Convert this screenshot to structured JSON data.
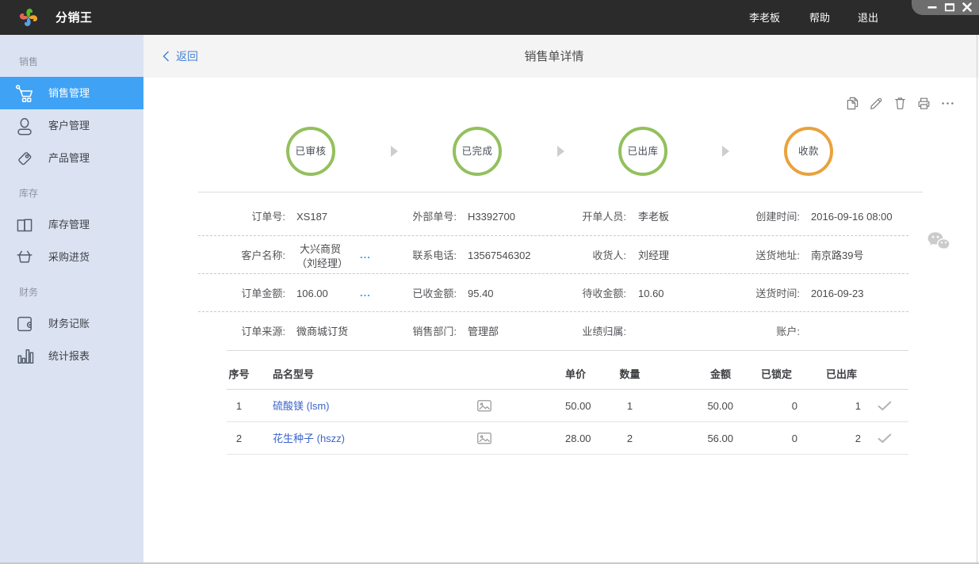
{
  "window": {
    "app_title": "分销王",
    "user": "李老板",
    "help": "帮助",
    "logout": "退出",
    "controls": [
      "minimize",
      "maximize",
      "close"
    ]
  },
  "sidebar": {
    "sections": [
      {
        "label": "销售",
        "items": [
          {
            "label": "销售管理",
            "icon": "cart-icon",
            "active": true
          },
          {
            "label": "客户管理",
            "icon": "user-icon",
            "active": false
          },
          {
            "label": "产品管理",
            "icon": "tag-icon",
            "active": false
          }
        ]
      },
      {
        "label": "库存",
        "items": [
          {
            "label": "库存管理",
            "icon": "book-icon",
            "active": false
          },
          {
            "label": "采购进货",
            "icon": "basket-icon",
            "active": false
          }
        ]
      },
      {
        "label": "财务",
        "items": [
          {
            "label": "财务记账",
            "icon": "wallet-icon",
            "active": false
          },
          {
            "label": "统计报表",
            "icon": "bar-chart-icon",
            "active": false
          }
        ]
      }
    ]
  },
  "header": {
    "back": "返回",
    "title": "销售单详情"
  },
  "toolbar": {
    "icons": [
      "copy-icon",
      "edit-icon",
      "delete-icon",
      "print-icon",
      "more-icon"
    ]
  },
  "steps": [
    {
      "label": "已审核",
      "color": "#93c05c"
    },
    {
      "label": "已完成",
      "color": "#93c05c"
    },
    {
      "label": "已出库",
      "color": "#93c05c"
    },
    {
      "label": "收款",
      "color": "#e9a23d"
    }
  ],
  "details": {
    "more_dots": "...",
    "rows": [
      {
        "cells": [
          {
            "label": "订单号:",
            "value": "XS187"
          },
          {
            "label": "外部单号:",
            "value": "H3392700"
          },
          {
            "label": "开单人员:",
            "value": "李老板"
          },
          {
            "label": "创建时间:",
            "value": "2016-09-16 08:00"
          }
        ]
      },
      {
        "cells": [
          {
            "label": "客户名称:",
            "value_line1": "大兴商贸",
            "value_line2": "（刘经理）",
            "more": true
          },
          {
            "label": "联系电话:",
            "value": "13567546302"
          },
          {
            "label": "收货人:",
            "value": "刘经理"
          },
          {
            "label": "送货地址:",
            "value": "南京路39号"
          }
        ]
      },
      {
        "cells": [
          {
            "label": "订单金额:",
            "value": "106.00",
            "more": true
          },
          {
            "label": "已收金额:",
            "value": "95.40"
          },
          {
            "label": "待收金额:",
            "value": "10.60"
          },
          {
            "label": "送货时间:",
            "value": "2016-09-23"
          }
        ]
      },
      {
        "cells": [
          {
            "label": "订单来源:",
            "value": "微商城订货"
          },
          {
            "label": "销售部门:",
            "value": "管理部"
          },
          {
            "label": "业绩归属:",
            "value": ""
          },
          {
            "label": "账户:",
            "value": ""
          }
        ]
      }
    ]
  },
  "items": {
    "headers": {
      "seq": "序号",
      "name": "品名型号",
      "price": "单价",
      "qty": "数量",
      "amount": "金额",
      "locked": "已锁定",
      "shipped": "已出库"
    },
    "rows": [
      {
        "seq": "1",
        "name": "硫酸镁 (lsm)",
        "price": "50.00",
        "qty": "1",
        "amount": "50.00",
        "locked": "0",
        "shipped": "1"
      },
      {
        "seq": "2",
        "name": "花生种子 (hszz)",
        "price": "28.00",
        "qty": "2",
        "amount": "56.00",
        "locked": "0",
        "shipped": "2"
      }
    ]
  },
  "colors": {
    "topbar": "#2b2b2b",
    "sidebar_bg": "#dbe3f3",
    "active_item": "#3fa2f5",
    "step_green": "#93c05c",
    "step_orange": "#e9a23d",
    "link_blue": "#3b64c9",
    "back_blue": "#4585d6",
    "more_dots_blue": "#3f9be0"
  }
}
